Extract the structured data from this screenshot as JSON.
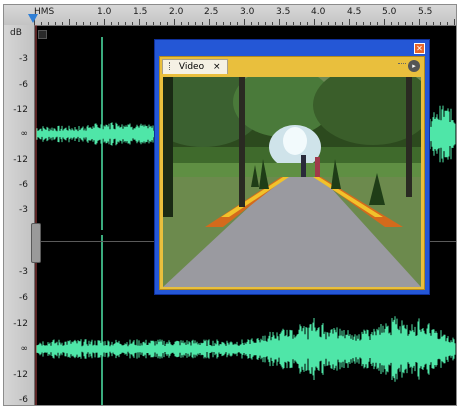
{
  "ruler": {
    "unit": "HMS",
    "ticks": [
      "1.0",
      "1.5",
      "2.0",
      "2.5",
      "3.0",
      "3.5",
      "4.0",
      "4.5",
      "5.0",
      "5.5"
    ]
  },
  "db_ruler": {
    "unit": "dB",
    "top_track": [
      "-3",
      "-6",
      "-12",
      "∞",
      "-12",
      "-6",
      "-3"
    ],
    "bottom_track": [
      "-3",
      "-6",
      "-12",
      "∞",
      "-12",
      "-6",
      "-6"
    ]
  },
  "video_window": {
    "tab_label": "Video",
    "tab_close": "×",
    "close_symbol": "✕",
    "menu_symbol": "▸"
  },
  "colors": {
    "waveform": "#4fe6a8",
    "window_blue": "#2457d6",
    "panel_gold": "#e9bf3d",
    "playhead": "#2f7fd6"
  }
}
